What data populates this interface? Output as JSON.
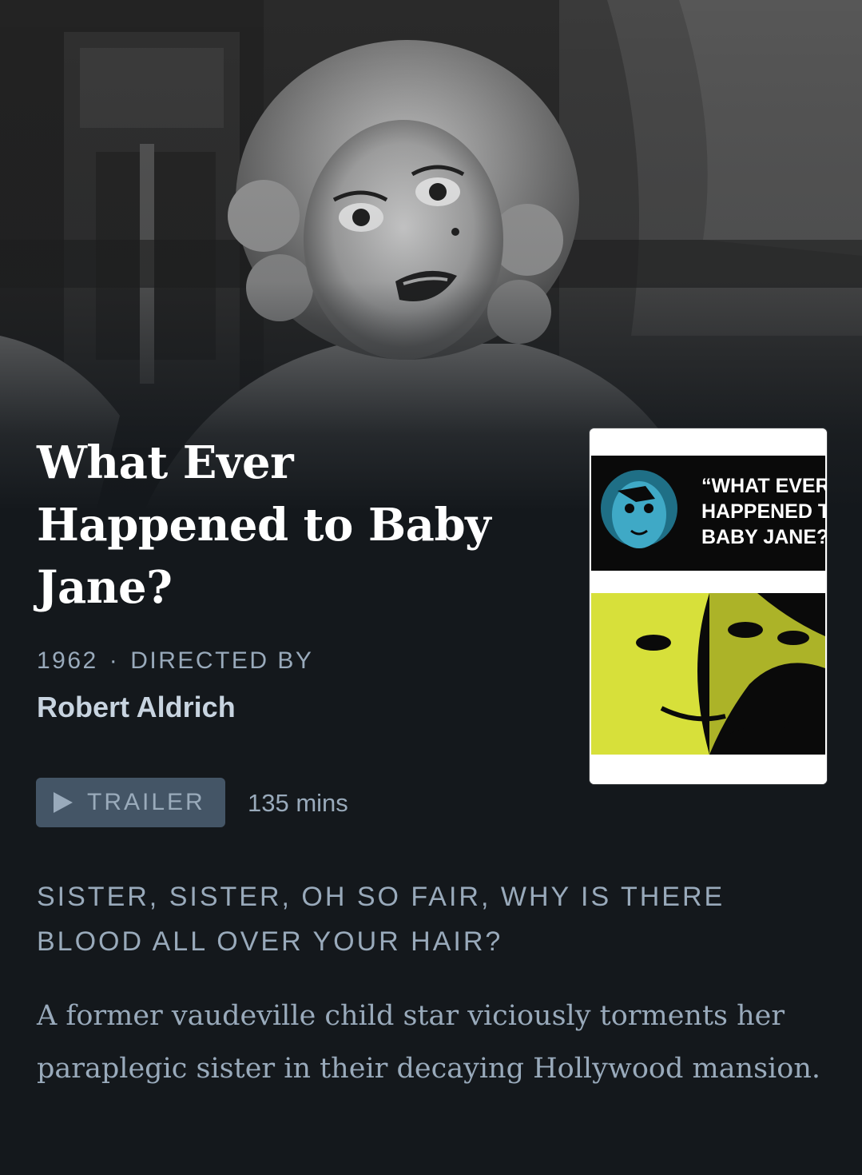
{
  "film": {
    "title": "What Ever Happened to Baby Jane?",
    "year": "1962",
    "separator": "·",
    "directed_by_label": "Directed by",
    "director": "Robert Aldrich",
    "trailer_label": "TRAILER",
    "runtime": "135 mins",
    "tagline": "Sister, sister, oh so fair, why is there blood all over your hair?",
    "synopsis": "A former vaudeville child star viciously torments her paraplegic sister in their decaying Hollywood mansion."
  },
  "poster": {
    "title_line1": "“WHAT EVER",
    "title_line2": "HAPPENED TO",
    "title_line3": "BABY JANE?”"
  },
  "colors": {
    "background": "#14181c",
    "muted_text": "#99aabb",
    "button_bg": "#445566",
    "poster_top": "#0a0a0a",
    "poster_doll": "#3fa9c6",
    "poster_yellow": "#d7e03a"
  },
  "icons": {
    "play": "play-icon"
  }
}
